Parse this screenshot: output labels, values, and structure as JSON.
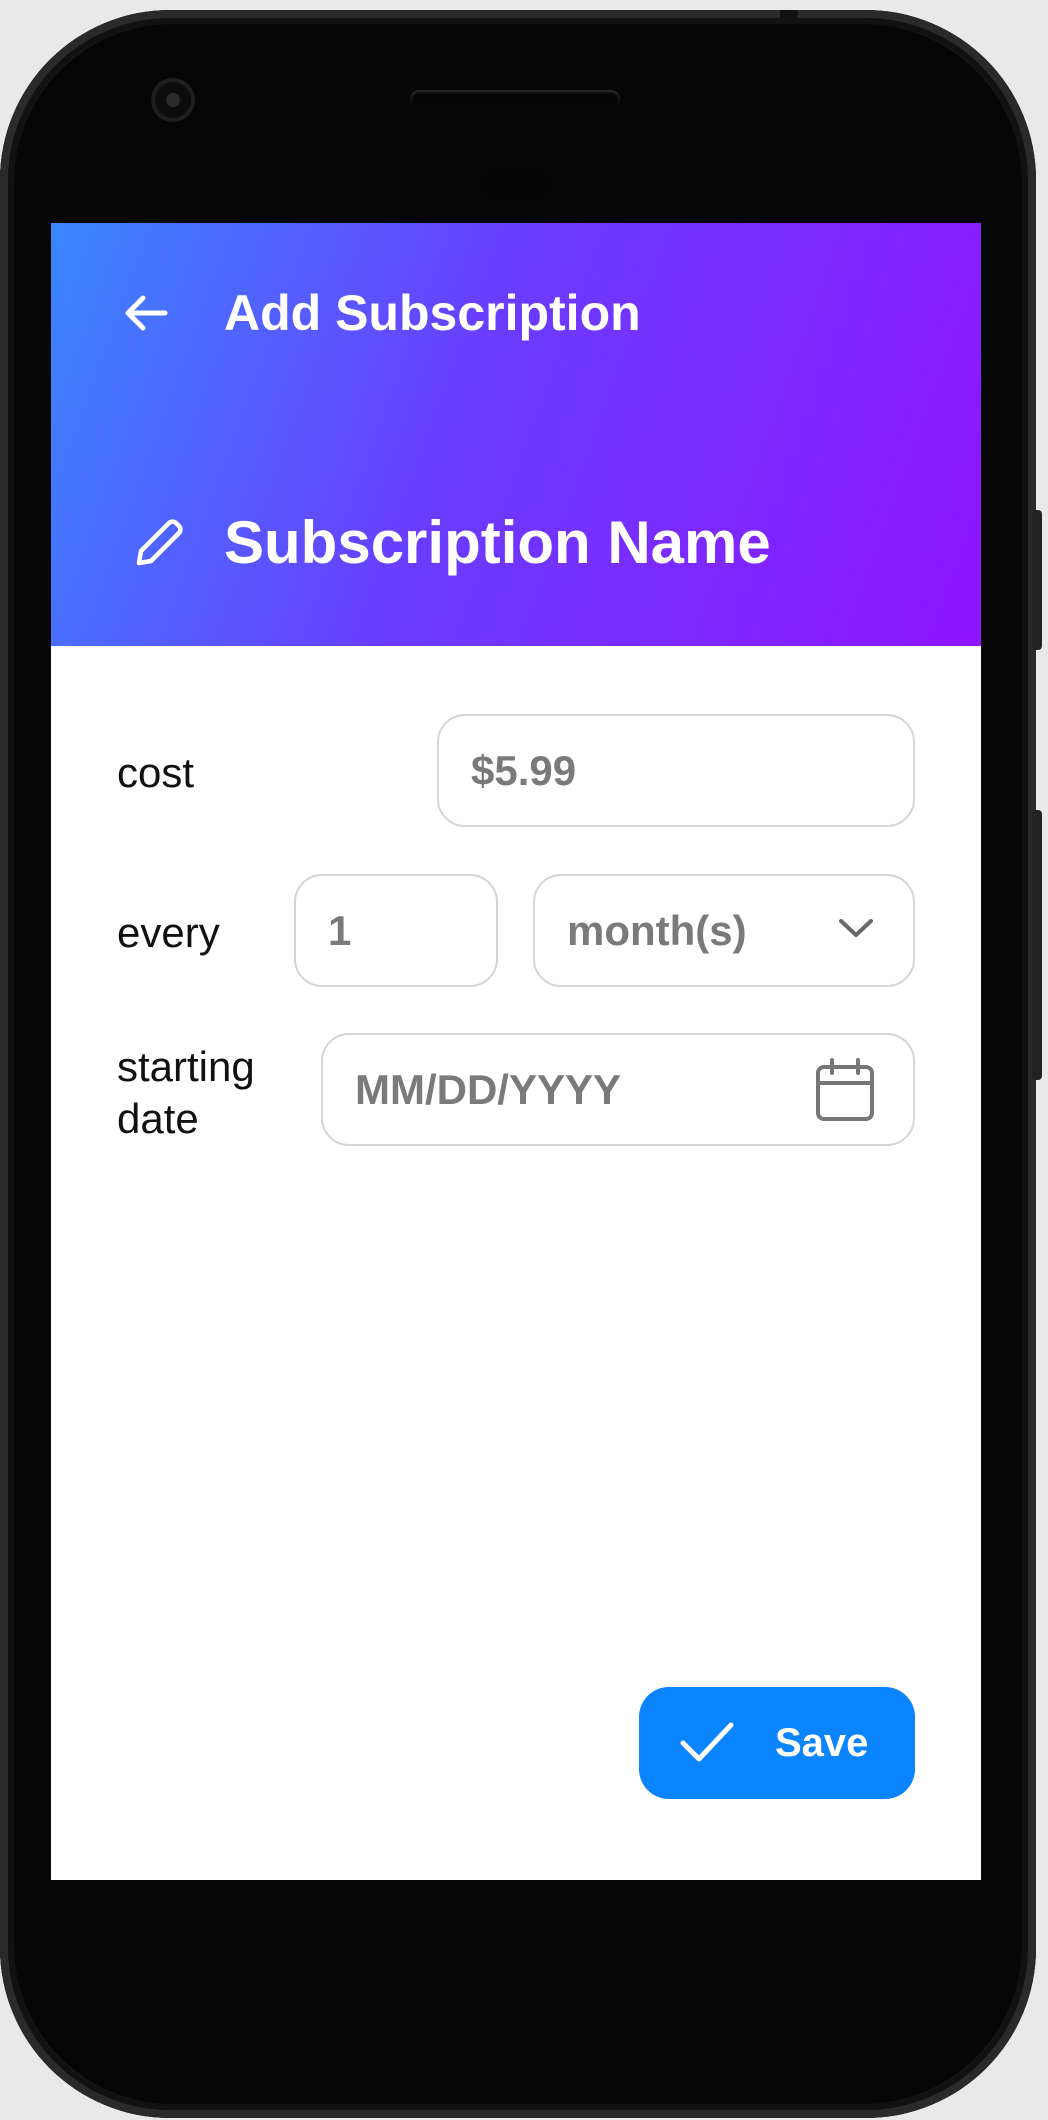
{
  "header": {
    "title": "Add Subscription",
    "subscription_name": "Subscription Name",
    "back_icon": "arrow-left-icon",
    "edit_icon": "pencil-icon",
    "gradient_colors": [
      "#3a86ff",
      "#8f14ff"
    ]
  },
  "form": {
    "cost": {
      "label": "cost",
      "value": "$5.99"
    },
    "every": {
      "label": "every",
      "count": "1",
      "unit": "month(s)",
      "unit_icon": "chevron-down-icon"
    },
    "starting_date": {
      "label_line1": "starting",
      "label_line2": "date",
      "placeholder": "MM/DD/YYYY",
      "icon": "calendar-icon"
    }
  },
  "save_button": {
    "label": "Save",
    "icon": "check-icon",
    "color": "#0a84ff"
  }
}
